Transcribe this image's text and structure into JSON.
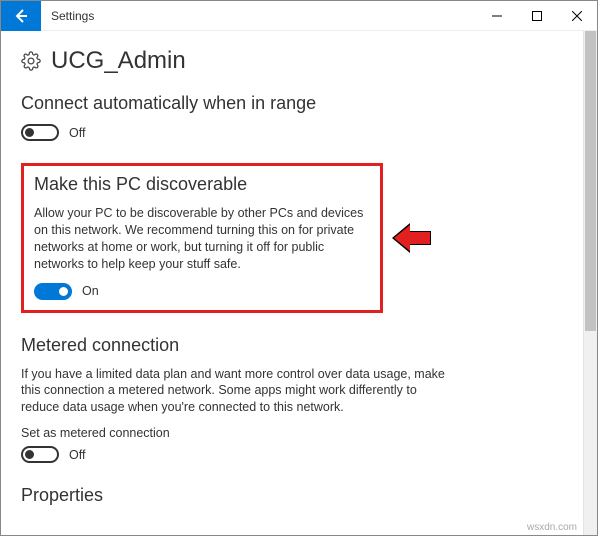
{
  "window": {
    "title": "Settings"
  },
  "page": {
    "title": "UCG_Admin"
  },
  "sections": {
    "auto_connect": {
      "title": "Connect automatically when in range",
      "toggle_state": "off",
      "toggle_label": "Off"
    },
    "discoverable": {
      "title": "Make this PC discoverable",
      "desc": "Allow your PC to be discoverable by other PCs and devices on this network. We recommend turning this on for private networks at home or work, but turning it off for public networks to help keep your stuff safe.",
      "toggle_state": "on",
      "toggle_label": "On"
    },
    "metered": {
      "title": "Metered connection",
      "desc": "If you have a limited data plan and want more control over data usage, make this connection a metered network. Some apps might work differently to reduce data usage when you're connected to this network.",
      "sublabel": "Set as metered connection",
      "toggle_state": "off",
      "toggle_label": "Off"
    },
    "properties": {
      "title": "Properties"
    }
  },
  "watermark": "wsxdn.com"
}
